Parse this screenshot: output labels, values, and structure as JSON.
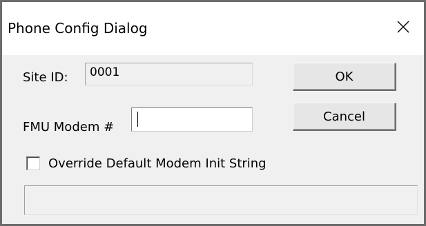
{
  "dialog": {
    "title": "Phone Config Dialog",
    "close_icon": "close-icon"
  },
  "site_id": {
    "label": "Site ID:",
    "value": "0001"
  },
  "fmu_modem": {
    "label": "FMU Modem #",
    "value": ""
  },
  "buttons": {
    "ok_label": "OK",
    "cancel_label": "Cancel"
  },
  "override": {
    "label": "Override Default Modem Init String",
    "checked": false,
    "init_string": ""
  }
}
